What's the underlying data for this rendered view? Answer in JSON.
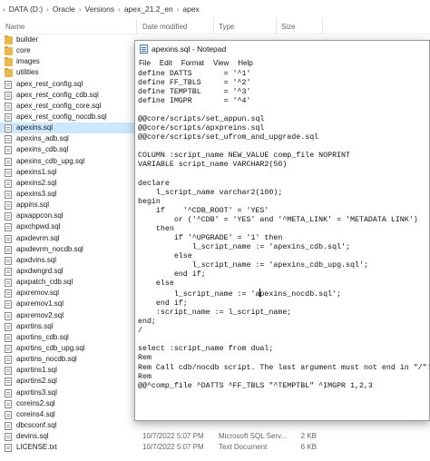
{
  "explorer": {
    "breadcrumb": [
      "DATA (D:)",
      "Oracle",
      "Versions",
      "apex_21.2_en",
      "apex"
    ],
    "columns": {
      "name": "Name",
      "date": "Date modified",
      "type": "Type",
      "size": "Size"
    },
    "rows": [
      {
        "name": "builder",
        "kind": "folder",
        "date": "",
        "type": "",
        "size": ""
      },
      {
        "name": "core",
        "kind": "folder",
        "date": "",
        "type": "",
        "size": ""
      },
      {
        "name": "images",
        "kind": "folder",
        "date": "",
        "type": "",
        "size": ""
      },
      {
        "name": "utilities",
        "kind": "folder",
        "date": "",
        "type": "",
        "size": ""
      },
      {
        "name": "apex_rest_config.sql",
        "kind": "file",
        "date": "",
        "type": "",
        "size": ""
      },
      {
        "name": "apex_rest_config_cdb.sql",
        "kind": "file",
        "date": "",
        "type": "",
        "size": ""
      },
      {
        "name": "apex_rest_config_core.sql",
        "kind": "file",
        "date": "",
        "type": "",
        "size": ""
      },
      {
        "name": "apex_rest_config_nocdb.sql",
        "kind": "file",
        "date": "",
        "type": "",
        "size": ""
      },
      {
        "name": "apexins.sql",
        "kind": "file",
        "date": "",
        "type": "",
        "size": "",
        "selected": true
      },
      {
        "name": "apexins_adb.sql",
        "kind": "file",
        "date": "",
        "type": "",
        "size": ""
      },
      {
        "name": "apexins_cdb.sql",
        "kind": "file",
        "date": "",
        "type": "",
        "size": ""
      },
      {
        "name": "apexins_cdb_upg.sql",
        "kind": "file",
        "date": "",
        "type": "",
        "size": ""
      },
      {
        "name": "apexins1.sql",
        "kind": "file",
        "date": "",
        "type": "",
        "size": ""
      },
      {
        "name": "apexins2.sql",
        "kind": "file",
        "date": "",
        "type": "",
        "size": ""
      },
      {
        "name": "apexins3.sql",
        "kind": "file",
        "date": "",
        "type": "",
        "size": ""
      },
      {
        "name": "appins.sql",
        "kind": "file",
        "date": "",
        "type": "",
        "size": ""
      },
      {
        "name": "apxappcon.sql",
        "kind": "file",
        "date": "",
        "type": "",
        "size": ""
      },
      {
        "name": "apxchpwd.sql",
        "kind": "file",
        "date": "",
        "type": "",
        "size": ""
      },
      {
        "name": "apxdevrm.sql",
        "kind": "file",
        "date": "",
        "type": "",
        "size": ""
      },
      {
        "name": "apxdevrm_nocdb.sql",
        "kind": "file",
        "date": "",
        "type": "",
        "size": ""
      },
      {
        "name": "apxdvins.sql",
        "kind": "file",
        "date": "",
        "type": "",
        "size": ""
      },
      {
        "name": "apxdwngrd.sql",
        "kind": "file",
        "date": "",
        "type": "",
        "size": ""
      },
      {
        "name": "apxpatch_cdb.sql",
        "kind": "file",
        "date": "",
        "type": "",
        "size": ""
      },
      {
        "name": "apxremov.sql",
        "kind": "file",
        "date": "",
        "type": "",
        "size": ""
      },
      {
        "name": "apxremov1.sql",
        "kind": "file",
        "date": "",
        "type": "",
        "size": ""
      },
      {
        "name": "apxremov2.sql",
        "kind": "file",
        "date": "",
        "type": "",
        "size": ""
      },
      {
        "name": "apxrtins.sql",
        "kind": "file",
        "date": "",
        "type": "",
        "size": ""
      },
      {
        "name": "apxrtins_cdb.sql",
        "kind": "file",
        "date": "",
        "type": "",
        "size": ""
      },
      {
        "name": "apxrtins_cdb_upg.sql",
        "kind": "file",
        "date": "",
        "type": "",
        "size": ""
      },
      {
        "name": "apxrtins_nocdb.sql",
        "kind": "file",
        "date": "",
        "type": "",
        "size": ""
      },
      {
        "name": "apxrtins1.sql",
        "kind": "file",
        "date": "",
        "type": "",
        "size": ""
      },
      {
        "name": "apxrtins2.sql",
        "kind": "file",
        "date": "",
        "type": "",
        "size": ""
      },
      {
        "name": "apxrtins3.sql",
        "kind": "file",
        "date": "",
        "type": "",
        "size": ""
      },
      {
        "name": "coreins2.sql",
        "kind": "file",
        "date": "",
        "type": "",
        "size": ""
      },
      {
        "name": "coreins4.sql",
        "kind": "file",
        "date": "",
        "type": "",
        "size": ""
      },
      {
        "name": "dbcsconf.sql",
        "kind": "file",
        "date": "",
        "type": "",
        "size": ""
      },
      {
        "name": "devins.sql",
        "kind": "file",
        "date": "10/7/2022 5:07 PM",
        "type": "Microsoft SQL Serv...",
        "size": "2 KB"
      },
      {
        "name": "LICENSE.txt",
        "kind": "file",
        "date": "10/7/2022 5:07 PM",
        "type": "Text Document",
        "size": "6 KB"
      }
    ]
  },
  "notepad": {
    "title": "apexins.sql - Notepad",
    "menu": [
      "File",
      "Edit",
      "Format",
      "View",
      "Help"
    ],
    "content_before_caret": "define DATTS       = '^1'\ndefine FF_TBLS     = '^2'\ndefine TEMPTBL     = '^3'\ndefine IMGPR       = '^4'\n\n@@core/scripts/set_appun.sql\n@@core/scripts/apxpreins.sql\n@@core/scripts/set_ufrom_and_upgrade.sql\n\nCOLUMN :script_name NEW_VALUE comp_file NOPRINT\nVARIABLE script_name VARCHAR2(50)\n\ndeclare\n    l_script_name varchar2(100);\nbegin\n    if    '^CDB_ROOT' = 'YES'\n        or ('^CDB' = 'YES' and '^META_LINK' = 'METADATA LINK')\n    then\n        if '^UPGRADE' = '1' then\n            l_script_name := 'apexins_cdb.sql';\n        else\n            l_script_name := 'apexins_cdb_upg.sql';\n        end if;\n    else\n        l_script_name := 'a",
    "content_after_caret": "pexins_nocdb.sql';\n    end if;\n    :script_name := l_script_name;\nend;\n/\n\nselect :script_name from dual;\nRem\nRem Call cdb/nocdb script. The last argument must not end in \"/\"!\nRem\n@@^comp_file ^DATTS ^FF_TBLS \"^TEMPTBL\" ^IMGPR 1,2,3"
  }
}
